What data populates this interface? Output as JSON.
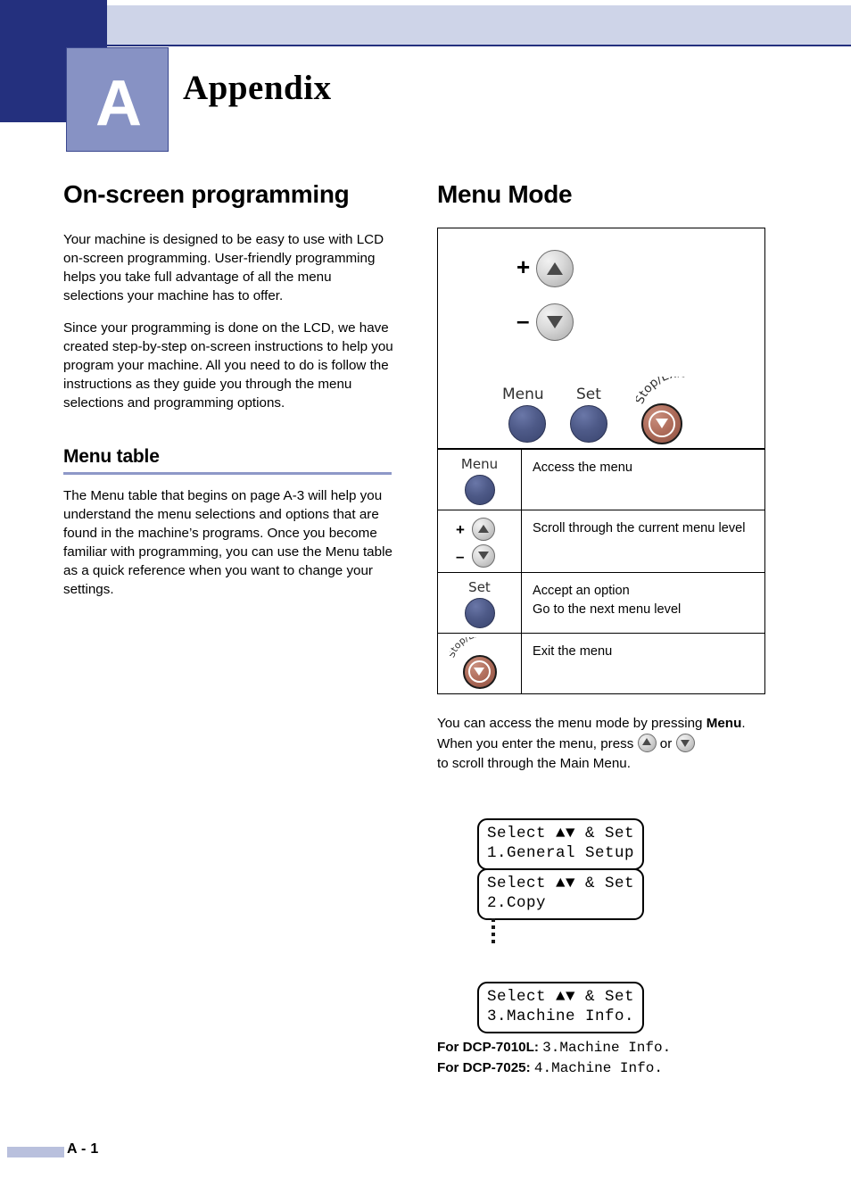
{
  "header": {
    "chapter_letter": "A",
    "title": "Appendix"
  },
  "left_column": {
    "section_title": "On-screen programming",
    "paragraphs": [
      "Your machine is designed to be easy to use with LCD on-screen programming. User-friendly programming helps you take full advantage of all the menu selections your machine has to offer.",
      "Since your programming is done on the LCD, we have created step-by-step on-screen instructions to help you program your machine. All you need to do is follow the instructions as they guide you through the menu selections and programming options."
    ],
    "subsection_title": "Menu table",
    "subsection_paragraph": "The Menu table that begins on page A-3 will help you understand the menu selections and options that are found in the machine’s programs. Once you become familiar with programming, you can use the Menu table as a quick reference when you want to change your settings."
  },
  "right_column": {
    "section_title": "Menu Mode",
    "control_panel": {
      "plus_sign": "+",
      "minus_sign": "–",
      "up_button": "up-arrow-button",
      "down_button": "down-arrow-button",
      "menu_label": "Menu",
      "set_label": "Set",
      "stop_exit_label": "Stop/Exit"
    },
    "function_table": {
      "rows": [
        {
          "key_label": "Menu",
          "key_type": "menu-button",
          "descriptions": [
            "Access the menu"
          ]
        },
        {
          "key_label": "",
          "key_type": "scroll-buttons",
          "plus": "+",
          "minus": "–",
          "descriptions": [
            "Scroll through the current menu level"
          ]
        },
        {
          "key_label": "Set",
          "key_type": "set-button",
          "descriptions": [
            "Accept an option",
            "Go to the next menu level"
          ]
        },
        {
          "key_label": "Stop/Exit",
          "key_type": "stop-exit-button",
          "descriptions": [
            "Exit the menu"
          ]
        }
      ]
    },
    "instructions": {
      "line1_before": "You can access the menu mode by pressing ",
      "line1_bold": "Menu",
      "line1_after": ".",
      "line2_before": "When you enter the menu, press ",
      "line2_mid": " or ",
      "line2_after": "to scroll through the Main Menu."
    },
    "lcd_displays": [
      {
        "line1": "Select ▲▼ & Set",
        "line2": "1.General Setup"
      },
      {
        "line1": "Select ▲▼ & Set",
        "line2": "2.Copy"
      },
      {
        "line1": "Select ▲▼ & Set",
        "line2": "3.Machine Info."
      }
    ],
    "ellipsis_dots": "vertical-ellipsis",
    "model_notes": [
      {
        "label": "For DCP-7010L:",
        "value": "3.Machine Info."
      },
      {
        "label": "For DCP-7025:",
        "value": "4.Machine Info."
      }
    ]
  },
  "footer": {
    "page_number": "A - 1"
  },
  "colors": {
    "navy": "#24307e",
    "lavender": "#ced4e8",
    "slate": "#8792c4",
    "rule_blue": "#8e98c8",
    "button_blue": "#4e5a88",
    "stop_red": "#b06e5c"
  }
}
